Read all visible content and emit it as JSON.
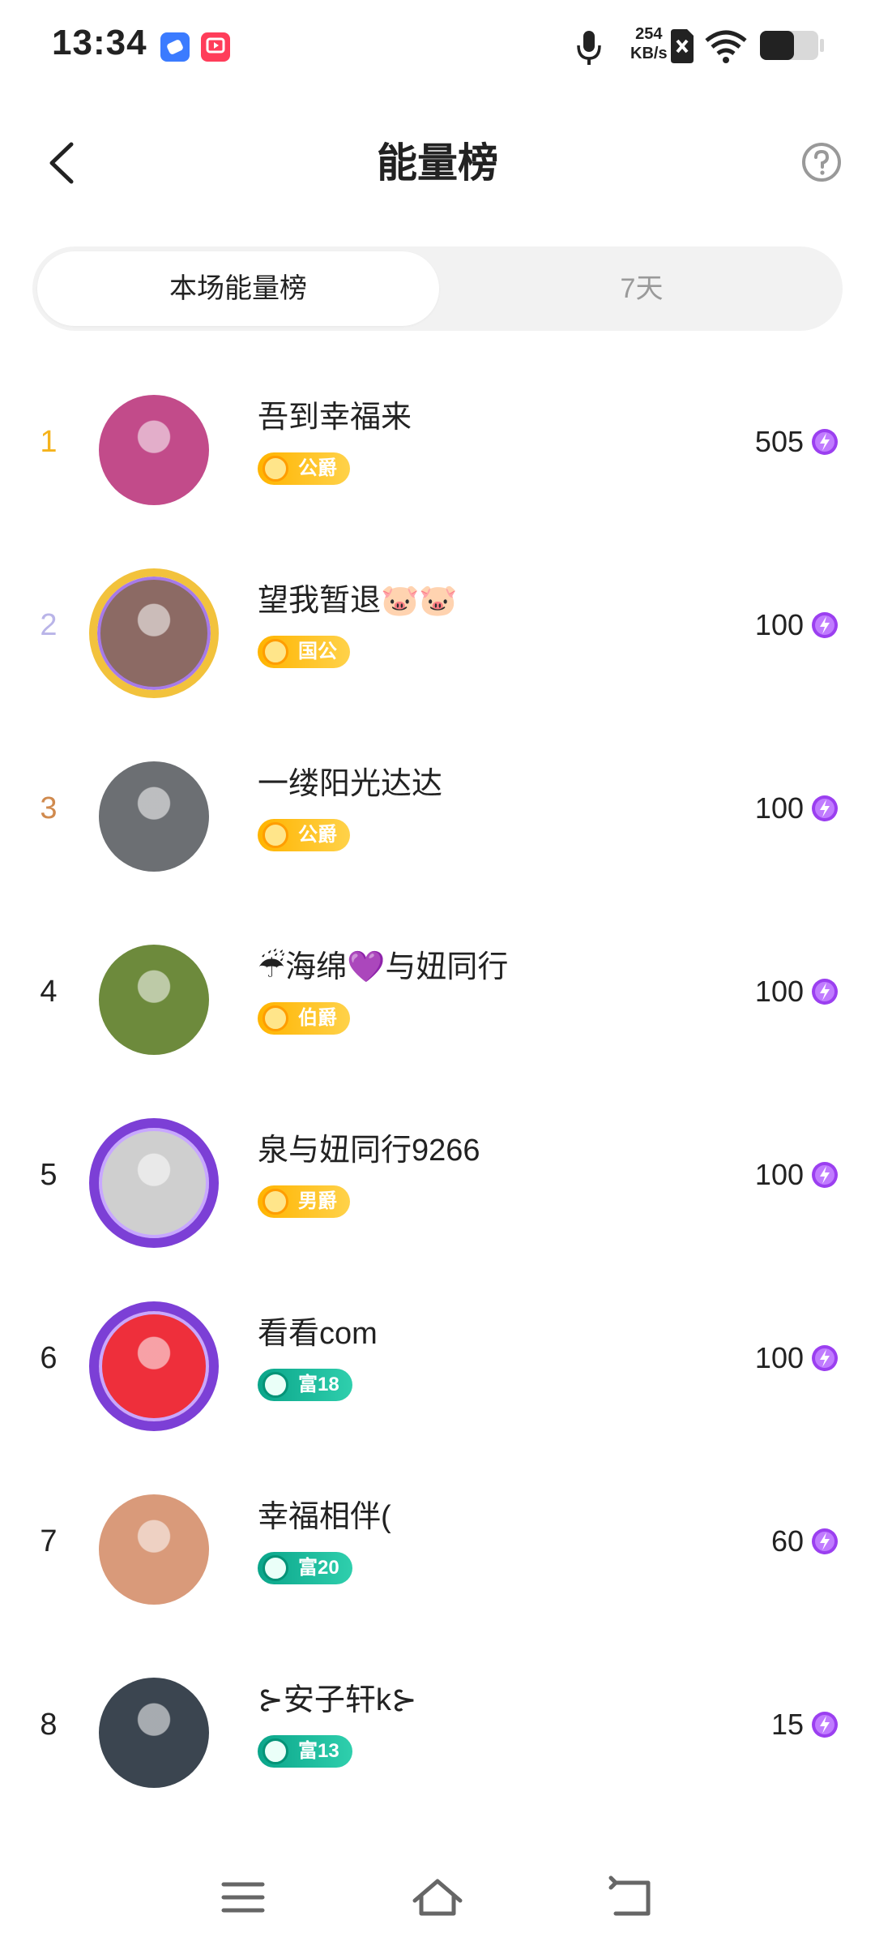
{
  "status_bar": {
    "time": "13:34",
    "net_speed_value": "254",
    "net_speed_unit": "KB/s",
    "icons": [
      "app-icon-blue",
      "app-icon-red",
      "mic-icon",
      "sim-off-icon",
      "wifi-icon",
      "battery-icon"
    ]
  },
  "header": {
    "title": "能量榜",
    "back_icon": "chevron-left-icon",
    "help_icon": "question-circle-icon"
  },
  "tabs": [
    {
      "label": "本场能量榜",
      "active": true
    },
    {
      "label": "7天",
      "active": false
    }
  ],
  "ranking": [
    {
      "rank": "1",
      "name": "吾到幸福来",
      "badge": "公爵",
      "badge_type": "gold",
      "score": "505",
      "avatar_frame": "none",
      "avatar_color": "#c24b8a"
    },
    {
      "rank": "2",
      "name": "望我暂退🐷🐷",
      "badge": "国公",
      "badge_type": "gold",
      "score": "100",
      "avatar_frame": "gold",
      "avatar_color": "#8c6a64"
    },
    {
      "rank": "3",
      "name": "一缕阳光达达",
      "badge": "公爵",
      "badge_type": "gold",
      "score": "100",
      "avatar_frame": "none",
      "avatar_color": "#6c6f73"
    },
    {
      "rank": "4",
      "name": "☔海绵💜与妞同行",
      "badge": "伯爵",
      "badge_type": "gold",
      "score": "100",
      "avatar_frame": "none",
      "avatar_color": "#6d8a3c"
    },
    {
      "rank": "5",
      "name": "泉与妞同行9266",
      "badge": "男爵",
      "badge_type": "gold",
      "score": "100",
      "avatar_frame": "purple",
      "avatar_color": "#cfcfcf"
    },
    {
      "rank": "6",
      "name": "看看com",
      "badge": "富18",
      "badge_type": "teal",
      "score": "100",
      "avatar_frame": "purple",
      "avatar_color": "#ee2f3b"
    },
    {
      "rank": "7",
      "name": "幸福相伴(",
      "badge": "富20",
      "badge_type": "teal",
      "score": "60",
      "avatar_frame": "none",
      "avatar_color": "#d99a7a"
    },
    {
      "rank": "8",
      "name": "⊱安子轩k⊱",
      "badge": "富13",
      "badge_type": "teal",
      "score": "15",
      "avatar_frame": "none",
      "avatar_color": "#3b4550"
    }
  ],
  "score_icon": "energy-lightning-icon",
  "nav": {
    "icons": [
      "menu-icon",
      "home-icon",
      "back-nav-icon"
    ]
  }
}
